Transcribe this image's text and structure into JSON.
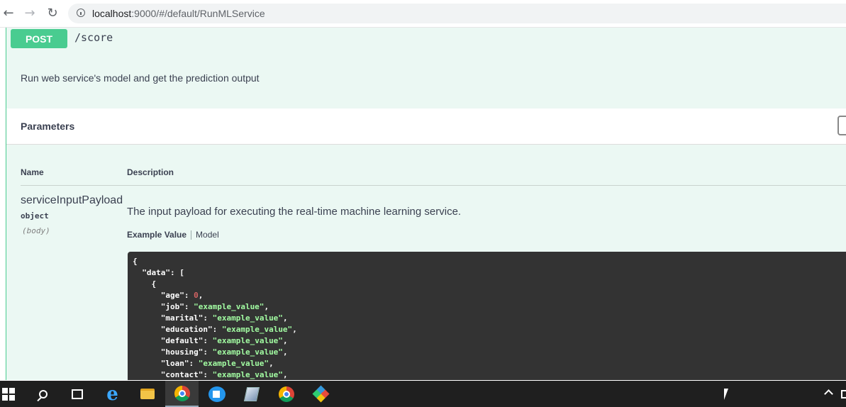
{
  "browser": {
    "back_icon": "arrow-left-icon",
    "forward_icon": "arrow-right-icon",
    "reload_icon": "reload-icon",
    "url_host": "localhost",
    "url_rest": ":9000/#/default/RunMLService"
  },
  "operation": {
    "method": "POST",
    "path": "/score",
    "method_color": "#49cc90",
    "background_color": "#ebf8f3",
    "description": "Run web service's model and get the prediction output"
  },
  "parameters": {
    "title": "Parameters",
    "col_name": "Name",
    "col_description": "Description",
    "param": {
      "name": "serviceInputPayload",
      "type": "object",
      "in": "(body)",
      "description": "The input payload for executing the real-time machine learning service.",
      "tab_example": "Example Value",
      "tab_model": "Model"
    }
  },
  "example_code": [
    {
      "t": "{"
    },
    {
      "t": "  \"data\": ["
    },
    {
      "t": "    {"
    },
    {
      "key": "age",
      "num": "0"
    },
    {
      "key": "job",
      "str": "example_value"
    },
    {
      "key": "marital",
      "str": "example_value"
    },
    {
      "key": "education",
      "str": "example_value"
    },
    {
      "key": "default",
      "str": "example_value"
    },
    {
      "key": "housing",
      "str": "example_value"
    },
    {
      "key": "loan",
      "str": "example_value"
    },
    {
      "key": "contact",
      "str": "example_value"
    }
  ],
  "taskbar": {
    "items": [
      "windows-start-icon",
      "search-icon",
      "task-view-icon",
      "internet-explorer-icon",
      "file-explorer-icon",
      "chrome-icon",
      "docker-icon",
      "notepad-icon",
      "chrome-icon",
      "git-icon"
    ],
    "active_index": 5,
    "tray": [
      "show-hidden-icons-chevron",
      "network-icon"
    ]
  }
}
